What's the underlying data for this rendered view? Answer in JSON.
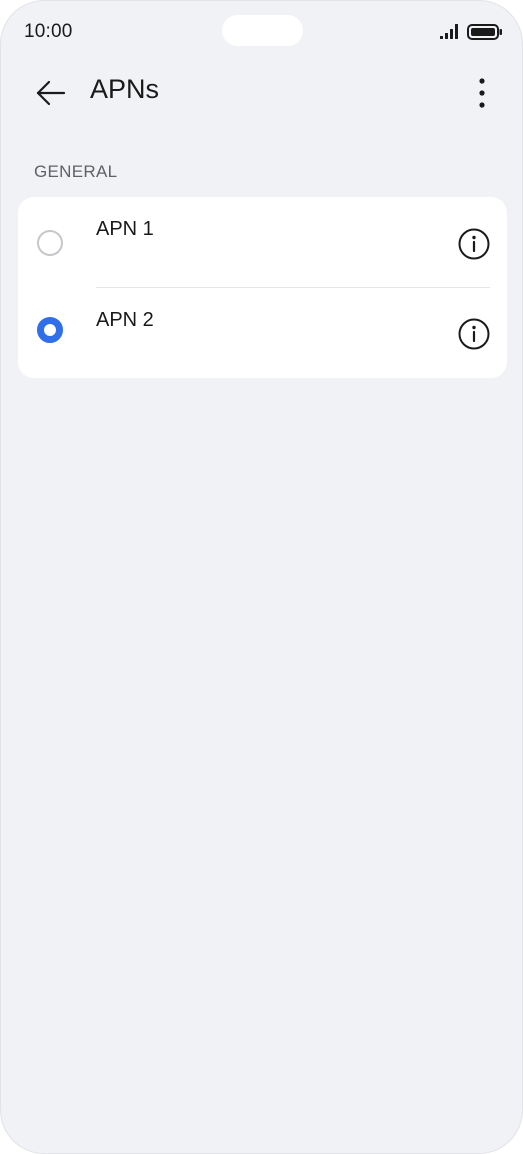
{
  "status_bar": {
    "time": "10:00",
    "signal_icon": "signal-bars-icon",
    "battery_icon": "battery-full-icon"
  },
  "app_bar": {
    "back_icon": "arrow-left-icon",
    "title": "APNs",
    "more_icon": "more-vertical-icon"
  },
  "section": {
    "header": "GENERAL"
  },
  "apns": [
    {
      "label": "APN 1",
      "selected": false,
      "info_icon": "info-icon"
    },
    {
      "label": "APN 2",
      "selected": true,
      "info_icon": "info-icon"
    }
  ],
  "colors": {
    "accent": "#2f6fea",
    "background": "#f1f2f6",
    "card": "#ffffff",
    "text_primary": "#1a1a1a",
    "text_secondary": "#5f6166"
  }
}
